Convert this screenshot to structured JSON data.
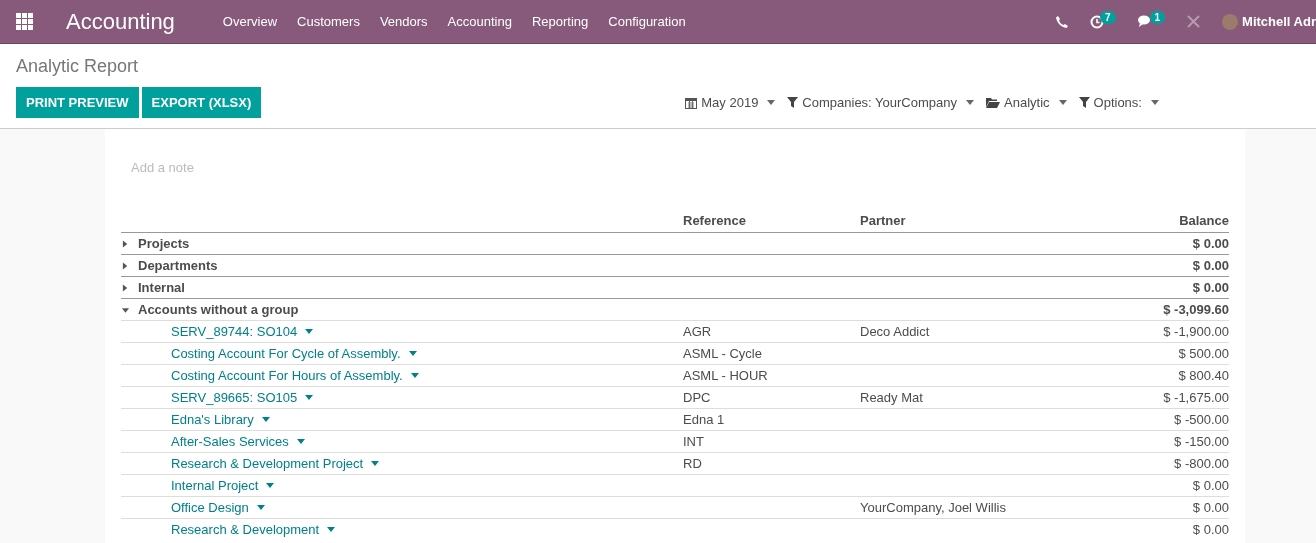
{
  "navbar": {
    "app_title": "Accounting",
    "menu": [
      "Overview",
      "Customers",
      "Vendors",
      "Accounting",
      "Reporting",
      "Configuration"
    ],
    "activity_count": "7",
    "message_count": "1",
    "user_name": "Mitchell Adr"
  },
  "control_panel": {
    "title": "Analytic Report",
    "buttons": [
      "PRINT PREVIEW",
      "EXPORT (XLSX)"
    ],
    "filters": [
      {
        "kind": "calendar",
        "label": "May 2019"
      },
      {
        "kind": "filter",
        "label": "Companies: YourCompany"
      },
      {
        "kind": "folder",
        "label": "Analytic"
      },
      {
        "kind": "filter",
        "label": "Options:"
      }
    ]
  },
  "report": {
    "note_placeholder": "Add a note",
    "columns": [
      "Reference",
      "Partner",
      "Balance"
    ],
    "groups": [
      {
        "name": "Projects",
        "balance": "$ 0.00",
        "expanded": false
      },
      {
        "name": "Departments",
        "balance": "$ 0.00",
        "expanded": false
      },
      {
        "name": "Internal",
        "balance": "$ 0.00",
        "expanded": false
      },
      {
        "name": "Accounts without a group",
        "balance": "$ -3,099.60",
        "expanded": true,
        "children": [
          {
            "name": "SERV_89744: SO104",
            "reference": "AGR",
            "partner": "Deco Addict",
            "balance": "$ -1,900.00"
          },
          {
            "name": "Costing Account For Cycle of Assembly.",
            "reference": "ASML - Cycle",
            "balance": "$ 500.00"
          },
          {
            "name": "Costing Account For Hours of Assembly.",
            "reference": "ASML - HOUR",
            "balance": "$ 800.40"
          },
          {
            "name": "SERV_89665: SO105",
            "reference": "DPC",
            "partner": "Ready Mat",
            "balance": "$ -1,675.00"
          },
          {
            "name": "Edna's Library",
            "reference": "Edna 1",
            "balance": "$ -500.00"
          },
          {
            "name": "After-Sales Services",
            "reference": "INT",
            "balance": "$ -150.00"
          },
          {
            "name": "Research & Development Project",
            "reference": "RD",
            "balance": "$ -800.00"
          },
          {
            "name": "Internal Project",
            "balance": "$ 0.00"
          },
          {
            "name": "Office Design",
            "partner": "YourCompany, Joel Willis",
            "balance": "$ 0.00"
          },
          {
            "name": "Research & Development",
            "balance": "$ 0.00"
          }
        ]
      }
    ]
  }
}
